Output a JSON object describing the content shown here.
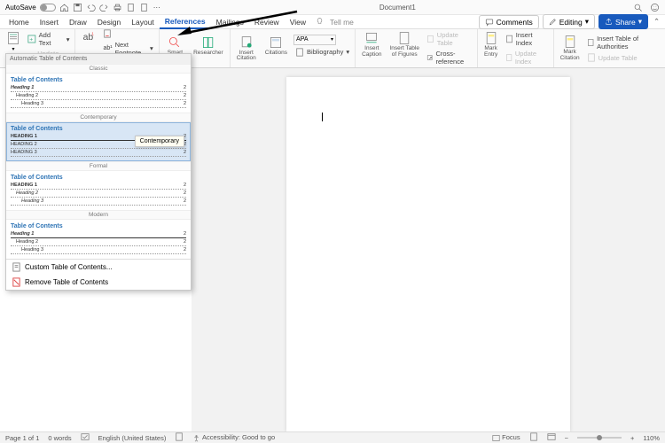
{
  "titlebar": {
    "autosave": "AutoSave",
    "docTitle": "Document1"
  },
  "tabs": {
    "home": "Home",
    "insert": "Insert",
    "draw": "Draw",
    "design": "Design",
    "layout": "Layout",
    "references": "References",
    "mailings": "Mailings",
    "review": "Review",
    "view": "View",
    "tellme": "Tell me"
  },
  "topright": {
    "comments": "Comments",
    "editing": "Editing",
    "share": "Share"
  },
  "ribbon": {
    "addText": "Add Text",
    "updateTable": "Update Table",
    "nextFootnote": "Next Footnote",
    "smartLookup": "Smart\nLookup",
    "researcher": "Researcher",
    "insertCitation": "Insert\nCitation",
    "citations": "Citations",
    "style": "APA",
    "bibliography": "Bibliography",
    "insertCaption": "Insert\nCaption",
    "insertTOF": "Insert Table\nof Figures",
    "updateTable2": "Update Table",
    "crossRef": "Cross-reference",
    "markEntry": "Mark\nEntry",
    "insertIndex": "Insert Index",
    "updateIndex": "Update Index",
    "markCitation": "Mark\nCitation",
    "insertTOA": "Insert Table of Authorities",
    "updateTable3": "Update Table"
  },
  "toc": {
    "header": "Automatic Table of Contents",
    "styles": {
      "classic": "Classic",
      "contemporary": "Contemporary",
      "formal": "Formal",
      "modern": "Modern"
    },
    "title": "Table of Contents",
    "h1": "Heading 1",
    "h2": "Heading 2",
    "h3": "Heading 3",
    "H1": "HEADING 1",
    "H2": "HEADING 2",
    "H3": "HEADING 3",
    "page": "2",
    "tooltip": "Contemporary",
    "custom": "Custom Table of Contents...",
    "remove": "Remove Table of Contents"
  },
  "status": {
    "page": "Page 1 of 1",
    "words": "0 words",
    "lang": "English (United States)",
    "access": "Accessibility: Good to go",
    "focus": "Focus",
    "zoom": "110%"
  }
}
